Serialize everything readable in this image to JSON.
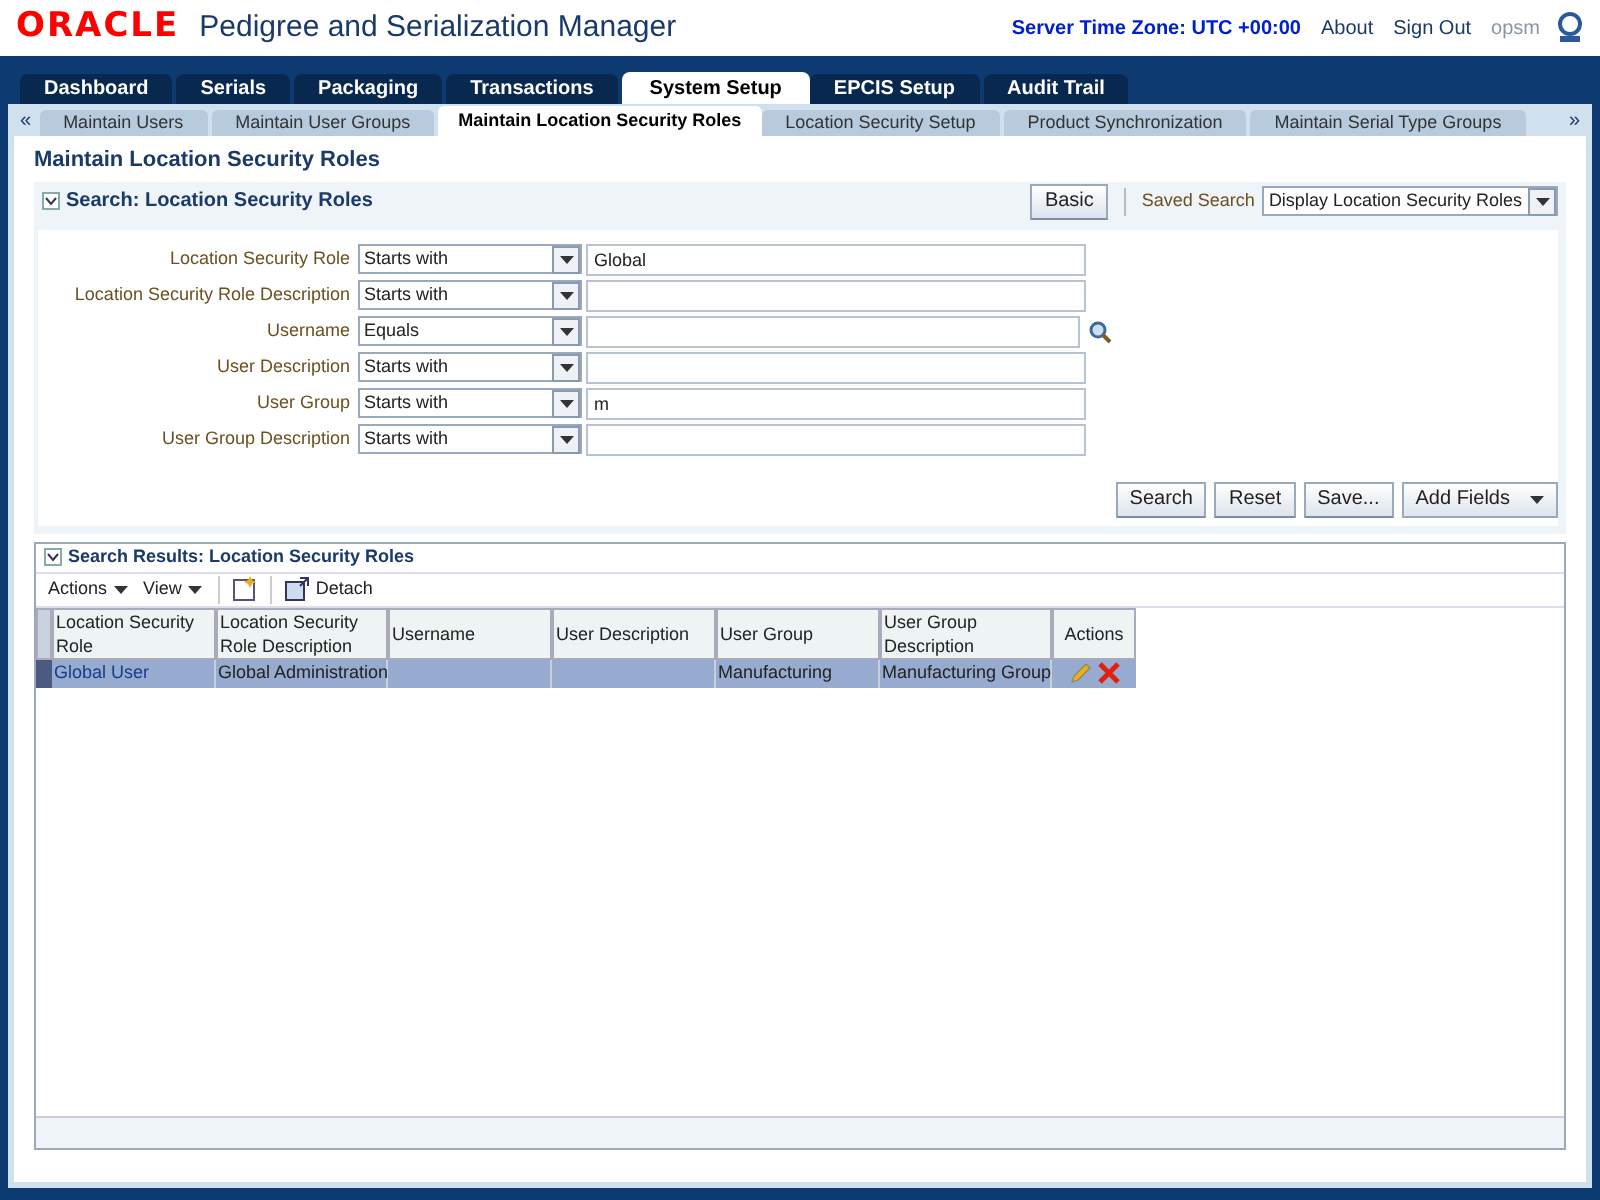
{
  "header": {
    "logo": "ORACLE",
    "app_title": "Pedigree and Serialization Manager",
    "server_time": "Server Time Zone: UTC +00:00",
    "links": [
      "About",
      "Sign Out"
    ],
    "user": "opsm"
  },
  "tabs": [
    {
      "label": "Dashboard",
      "selected": false
    },
    {
      "label": "Serials",
      "selected": false
    },
    {
      "label": "Packaging",
      "selected": false
    },
    {
      "label": "Transactions",
      "selected": false
    },
    {
      "label": "System Setup",
      "selected": true
    },
    {
      "label": "EPCIS Setup",
      "selected": false
    },
    {
      "label": "Audit Trail",
      "selected": false
    }
  ],
  "subtabs": {
    "prev": "«",
    "next": "»",
    "items": [
      {
        "label": "Maintain Users",
        "selected": false
      },
      {
        "label": "Maintain User Groups",
        "selected": false
      },
      {
        "label": "Maintain Location Security Roles",
        "selected": true
      },
      {
        "label": "Location Security Setup",
        "selected": false
      },
      {
        "label": "Product Synchronization",
        "selected": false
      },
      {
        "label": "Maintain Serial Type Groups",
        "selected": false
      }
    ]
  },
  "page_title": "Maintain Location Security Roles",
  "search": {
    "title": "Search: Location Security Roles",
    "basic_button": "Basic",
    "saved_search_label": "Saved Search",
    "saved_search_value": "Display Location Security Roles",
    "fields": [
      {
        "label": "Location Security Role",
        "operator": "Starts with",
        "value": "Global",
        "lookup": false
      },
      {
        "label": "Location Security Role Description",
        "operator": "Starts with",
        "lookup": false
      },
      {
        "label": "Username",
        "operator": "Equals",
        "lookup": true
      },
      {
        "label": "User Description",
        "operator": "Starts with",
        "lookup": false
      },
      {
        "label": "User Group",
        "operator": "Starts with",
        "value": "m",
        "lookup": false
      },
      {
        "label": "User Group Description",
        "operator": "Starts with",
        "lookup": false
      }
    ],
    "buttons": [
      "Search",
      "Reset",
      "Save..."
    ],
    "add_fields": "Add Fields"
  },
  "results": {
    "title": "Search Results: Location Security Roles",
    "menus": [
      "Actions",
      "View"
    ],
    "detach": "Detach",
    "columns": [
      "Location Security Role",
      "Location Security Role Description",
      "Username",
      "User Description",
      "User Group",
      "User Group Description",
      "Actions"
    ],
    "rows": [
      {
        "selected": true,
        "cells": [
          "Global User",
          "Global Administration",
          "",
          "",
          "Manufacturing",
          "Manufacturing Group"
        ]
      }
    ]
  }
}
